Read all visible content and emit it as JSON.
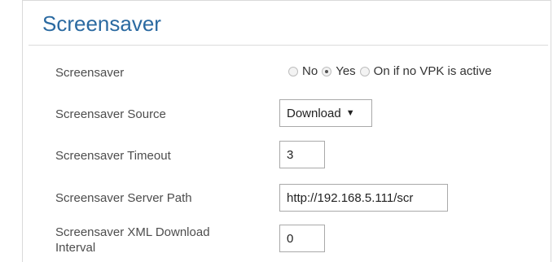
{
  "section": {
    "title": "Screensaver"
  },
  "fields": {
    "screensaver": {
      "label": "Screensaver",
      "options": [
        "No",
        "Yes",
        "On if no VPK is active"
      ],
      "selected": "Yes"
    },
    "source": {
      "label": "Screensaver Source",
      "value": "Download"
    },
    "timeout": {
      "label": "Screensaver Timeout",
      "value": "3"
    },
    "server_path": {
      "label": "Screensaver Server Path",
      "value": "http://192.168.5.111/scr"
    },
    "xml_interval": {
      "label_line1": "Screensaver XML Download",
      "label_line2": "Interval",
      "value": "0"
    }
  }
}
